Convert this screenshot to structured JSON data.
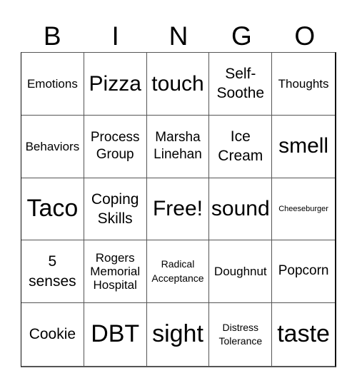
{
  "card": {
    "header": [
      "B",
      "I",
      "N",
      "G",
      "O"
    ],
    "cells": [
      [
        {
          "text": "Emotions",
          "size": "s-s"
        },
        {
          "text": "Pizza",
          "size": "s-l"
        },
        {
          "text": "touch",
          "size": "s-l"
        },
        {
          "text": "Self-\nSoothe",
          "size": "s-m"
        },
        {
          "text": "Thoughts",
          "size": "s-s"
        }
      ],
      [
        {
          "text": "Behaviors",
          "size": "s-s"
        },
        {
          "text": "Process\nGroup",
          "size": "s-ms"
        },
        {
          "text": "Marsha\nLinehan",
          "size": "s-ms"
        },
        {
          "text": "Ice\nCream",
          "size": "s-m"
        },
        {
          "text": "smell",
          "size": "s-l"
        }
      ],
      [
        {
          "text": "Taco",
          "size": "s-xl"
        },
        {
          "text": "Coping\nSkills",
          "size": "s-m"
        },
        {
          "text": "Free!",
          "size": "s-l"
        },
        {
          "text": "sound",
          "size": "s-l"
        },
        {
          "text": "Cheeseburger",
          "size": "s-xxs"
        }
      ],
      [
        {
          "text": "5\nsenses",
          "size": "s-m"
        },
        {
          "text": "Rogers\nMemorial\nHospital",
          "size": "s-s"
        },
        {
          "text": "Radical\nAcceptance",
          "size": "s-xs"
        },
        {
          "text": "Doughnut",
          "size": "s-s"
        },
        {
          "text": "Popcorn",
          "size": "s-ms"
        }
      ],
      [
        {
          "text": "Cookie",
          "size": "s-m"
        },
        {
          "text": "DBT",
          "size": "s-xl"
        },
        {
          "text": "sight",
          "size": "s-xl"
        },
        {
          "text": "Distress\nTolerance",
          "size": "s-xs"
        },
        {
          "text": "taste",
          "size": "s-xl"
        }
      ]
    ]
  }
}
